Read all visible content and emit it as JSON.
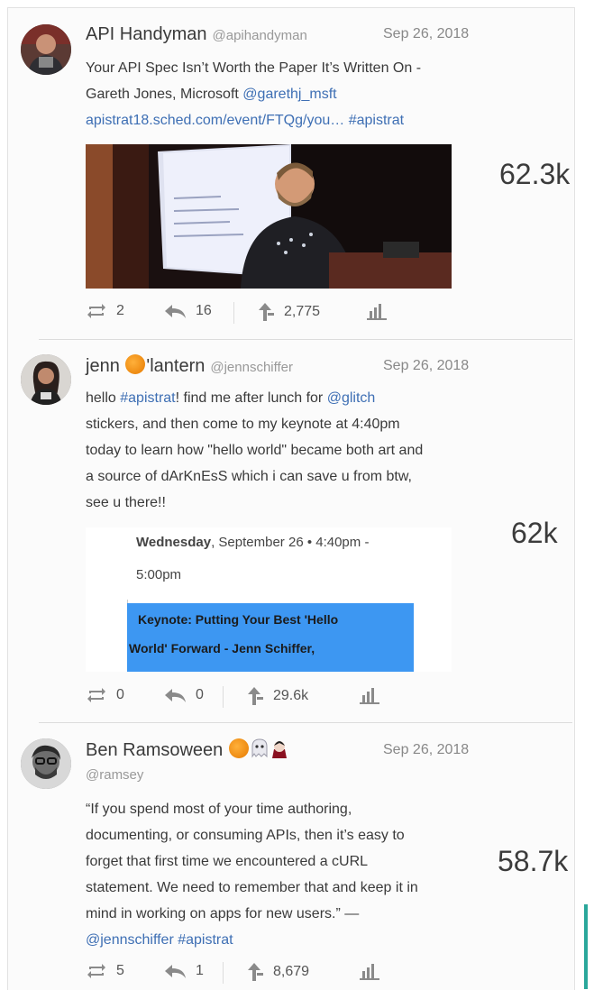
{
  "tweets": [
    {
      "author": "API Handyman",
      "handle": "@apihandyman",
      "date": "Sep 26, 2018",
      "line1": "Your API Spec Isn’t Worth the Paper It’s Written On -",
      "line2_text": "Gareth Jones, Microsoft ",
      "line2_link": "@garethj_msft",
      "line3_link": "apistrat18.sched.com/event/FTQg/you…",
      "line3_tag": "#apistrat",
      "impressions": "62.3k",
      "retweets": "2",
      "replies": "16",
      "shares": "2,775"
    },
    {
      "author_a": "jenn ",
      "author_b": "'lantern",
      "handle": "@jennschiffer",
      "date": "Sep 26, 2018",
      "l1_a": "hello ",
      "l1_tag": "#apistrat",
      "l1_b": "! find me after lunch for ",
      "l1_link": "@glitch",
      "l2": "stickers, and then come to my keynote at 4:40pm",
      "l3": "today to learn how \"hello world\" became both art and",
      "l4": "a source of dArKnEsS which i can save u from btw,",
      "l5": "see u there!!",
      "card_day": "Wednesday",
      "card_date": ", September 26 • 4:40pm -",
      "card_time": "5:00pm",
      "card_event_1": "Keynote: Putting Your Best 'Hello",
      "card_event_2": "World' Forward - Jenn Schiffer,",
      "impressions": "62k",
      "retweets": "0",
      "replies": "0",
      "shares": "29.6k"
    },
    {
      "author": "Ben Ramsoween ",
      "handle": "@ramsey",
      "date": "Sep 26, 2018",
      "l1": "“If you spend most of your time authoring,",
      "l2": "documenting, or consuming APIs, then it’s easy to",
      "l3": "forget that first time we encountered a cURL",
      "l4": "statement. We need to remember that and keep it in",
      "l5": "mind in working on apps for new users.” —",
      "l6_link": "@jennschiffer",
      "l6_tag": "#apistrat",
      "impressions": "58.7k",
      "retweets": "5",
      "replies": "1",
      "shares": "8,679"
    }
  ],
  "colors": {
    "link": "#3e6fb4",
    "accent": "#2aa79b",
    "calendar_block": "#3d97f2"
  },
  "icons": [
    "retweet-icon",
    "reply-icon",
    "share-icon",
    "stats-bar-icon",
    "pumpkin-emoji",
    "ghost-emoji",
    "vampire-emoji"
  ]
}
